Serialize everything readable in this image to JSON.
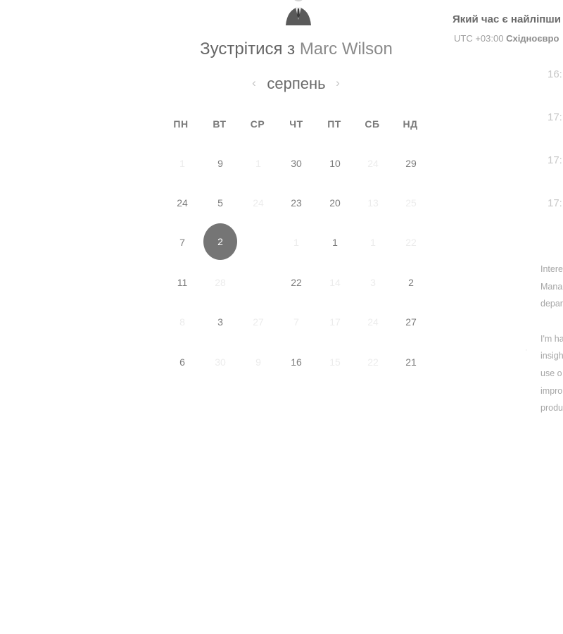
{
  "header": {
    "meet_prefix": "Зустрітися з ",
    "host_name": "Marc Wilson"
  },
  "calendar": {
    "month": "серпень",
    "prev_icon": "chevron-left-icon",
    "next_icon": "chevron-right-icon",
    "weekdays": [
      "ПН",
      "ВТ",
      "СР",
      "ЧТ",
      "ПТ",
      "СБ",
      "НД"
    ],
    "rows": [
      [
        {
          "text": "1",
          "state": "unavailable"
        },
        {
          "text": "9",
          "state": "available"
        },
        {
          "text": "1",
          "state": "unavailable"
        },
        {
          "text": "30",
          "state": "available"
        },
        {
          "text": "10",
          "state": "available"
        },
        {
          "text": "24",
          "state": "unavailable"
        },
        {
          "text": "29",
          "state": "available"
        }
      ],
      [
        {
          "text": "24",
          "state": "available"
        },
        {
          "text": "5",
          "state": "available"
        },
        {
          "text": "24",
          "state": "unavailable"
        },
        {
          "text": "23",
          "state": "available"
        },
        {
          "text": "20",
          "state": "available"
        },
        {
          "text": "13",
          "state": "unavailable"
        },
        {
          "text": "25",
          "state": "unavailable"
        }
      ],
      [
        {
          "text": "7",
          "state": "available"
        },
        {
          "text": "2",
          "state": "selected"
        },
        {
          "text": "",
          "state": "empty"
        },
        {
          "text": "1",
          "state": "unavailable"
        },
        {
          "text": "1",
          "state": "available"
        },
        {
          "text": "1",
          "state": "unavailable"
        },
        {
          "text": "22",
          "state": "unavailable"
        }
      ],
      [
        {
          "text": "11",
          "state": "available"
        },
        {
          "text": "28",
          "state": "unavailable"
        },
        {
          "text": "",
          "state": "empty"
        },
        {
          "text": "22",
          "state": "available"
        },
        {
          "text": "14",
          "state": "unavailable"
        },
        {
          "text": "3",
          "state": "unavailable"
        },
        {
          "text": "2",
          "state": "available"
        }
      ],
      [
        {
          "text": "8",
          "state": "unavailable"
        },
        {
          "text": "3",
          "state": "available"
        },
        {
          "text": "27",
          "state": "unavailable"
        },
        {
          "text": "7",
          "state": "unavailable"
        },
        {
          "text": "17",
          "state": "unavailable"
        },
        {
          "text": "24",
          "state": "unavailable"
        },
        {
          "text": "27",
          "state": "available"
        }
      ],
      [
        {
          "text": "6",
          "state": "available"
        },
        {
          "text": "30",
          "state": "unavailable"
        },
        {
          "text": "9",
          "state": "unavailable"
        },
        {
          "text": "16",
          "state": "available"
        },
        {
          "text": "15",
          "state": "unavailable"
        },
        {
          "text": "22",
          "state": "unavailable"
        },
        {
          "text": "21",
          "state": "available"
        }
      ]
    ]
  },
  "scheduling": {
    "question": "Який час є найліпши",
    "timezone_prefix": "UTC +03:00 ",
    "timezone_name": "Східноєвро",
    "slots": [
      "16:",
      "17:",
      "17:",
      "17:"
    ]
  },
  "description": {
    "paragraph1": [
      "Intere",
      "Mana",
      "depar"
    ],
    "paragraph2": [
      "I'm ha",
      "insigh",
      "use o",
      "impro",
      "produ"
    ],
    "aside_mark": "·"
  },
  "colors": {
    "selected_day": "#757575",
    "available_day_text": "#7c7c7c",
    "unavailable_day_text": "#ececec",
    "page_background": "#ffffff"
  }
}
